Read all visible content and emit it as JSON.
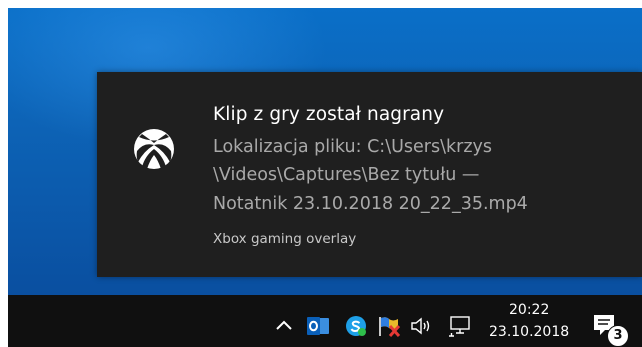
{
  "toast": {
    "title": "Klip z gry został nagrany",
    "body_lines": [
      "Lokalizacja pliku: C:\\Users\\krzys",
      "\\Videos\\Captures\\Bez tytułu —",
      "Notatnik 23.10.2018 20_22_35.mp4"
    ],
    "source": "Xbox gaming overlay",
    "icon": "xbox-icon"
  },
  "taskbar": {
    "tray_icons": [
      "chevron-up-icon",
      "outlook-icon",
      "skype-icon",
      "security-flag-icon",
      "volume-icon",
      "network-icon"
    ],
    "clock": {
      "time": "20:22",
      "date": "23.10.2018"
    },
    "notifications_count": "3"
  },
  "colors": {
    "desktop": "#0d63b6",
    "toast_bg": "#1f1f1f",
    "taskbar_bg": "#101010"
  }
}
